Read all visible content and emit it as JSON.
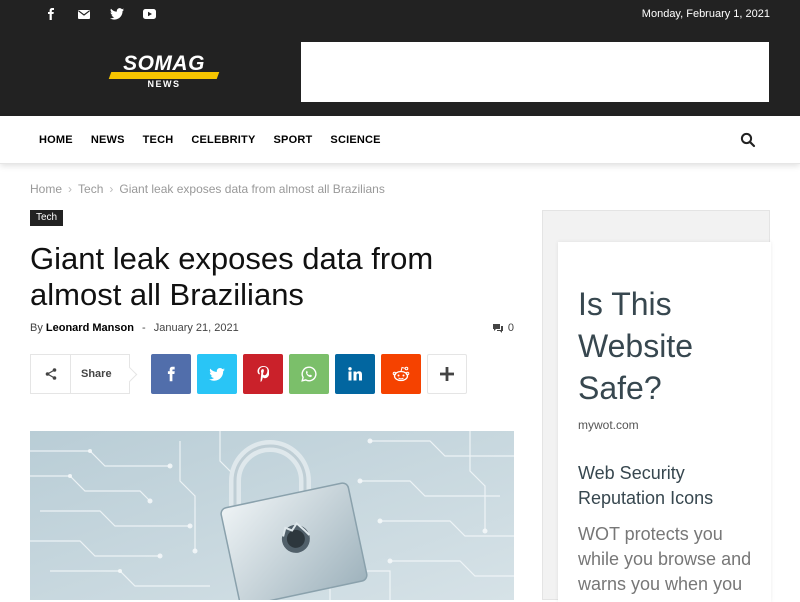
{
  "topbar": {
    "date": "Monday, February 1, 2021",
    "social_icons": [
      "facebook-icon",
      "mail-icon",
      "twitter-icon",
      "youtube-icon"
    ]
  },
  "logo": {
    "word": "SOMAG",
    "sub": "NEWS"
  },
  "nav": {
    "items": [
      "HOME",
      "NEWS",
      "TECH",
      "CELEBRITY",
      "SPORT",
      "SCIENCE"
    ]
  },
  "breadcrumb": {
    "items": [
      "Home",
      "Tech",
      "Giant leak exposes data from almost all Brazilians"
    ]
  },
  "article": {
    "category": "Tech",
    "title": "Giant leak exposes data from almost all Brazilians",
    "by": "By",
    "author": "Leonard Manson",
    "dash": "-",
    "date": "January 21, 2021",
    "comments": "0"
  },
  "share": {
    "label": "Share",
    "buttons": [
      {
        "name": "facebook",
        "color": "#516eab"
      },
      {
        "name": "twitter",
        "color": "#29c5f6"
      },
      {
        "name": "pinterest",
        "color": "#ca212a"
      },
      {
        "name": "whatsapp",
        "color": "#7bbf6a"
      },
      {
        "name": "linkedin",
        "color": "#0266a0"
      },
      {
        "name": "reddit",
        "color": "#f54200"
      }
    ]
  },
  "sidebar_ad": {
    "headline": "Is This Website Safe?",
    "url": "mywot.com",
    "subheading": "Web Security Reputation Icons",
    "body": "WOT protects you while you browse and warns you when you"
  },
  "colors": {
    "dark_bg": "#222222",
    "accent": "#f5c400"
  }
}
